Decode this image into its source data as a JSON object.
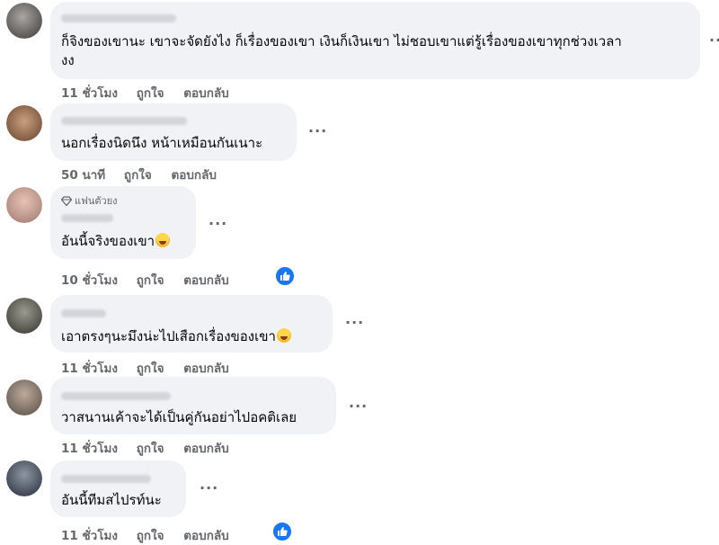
{
  "comments": [
    {
      "author": "",
      "text_lines": [
        "ก็จิงของเขานะ เขาจะจัดยังไง ก็เรื่องของเขา เงินก็เงินเขา ไม่ชอบเขาแต่รู้เรื่องของเขาทุกช่วงเวลา",
        "งง"
      ],
      "time": "11 ชั่วโมง",
      "like": "ถูกใจ",
      "reply": "ตอบกลับ"
    },
    {
      "author": "",
      "text": "นอกเรื่องนิดนึง หน้าเหมือนกันเนาะ",
      "time": "50 นาที",
      "like": "ถูกใจ",
      "reply": "ตอบกลับ"
    },
    {
      "badge": "แฟนตัวยง",
      "author": "",
      "text": "อันนี้จริงของเขา",
      "emoji": "rolling-laugh-emoji",
      "time": "10 ชั่วโมง",
      "like": "ถูกใจ",
      "reply": "ตอบกลับ",
      "reaction": "like"
    },
    {
      "author": "",
      "text": "เอาตรงๆนะมึงน่ะไปเสือกเรื่องของเขา",
      "emoji": "rolling-laugh-emoji",
      "time": "11 ชั่วโมง",
      "like": "ถูกใจ",
      "reply": "ตอบกลับ"
    },
    {
      "author": "",
      "text": "วาสนานเค้าจะได้เป็นคู่กันอย่าไปอคติเลย",
      "time": "11 ชั่วโมง",
      "like": "ถูกใจ",
      "reply": "ตอบกลับ"
    },
    {
      "author": "",
      "text": "อันนี้ทีมสไปรท์นะ",
      "time": "11 ชั่วโมง",
      "like": "ถูกใจ",
      "reply": "ตอบกลับ",
      "reaction": "like"
    }
  ],
  "more_glyph": "···",
  "colors": {
    "bubble": "#f0f2f5",
    "meta": "#65676b",
    "like_blue": "#1877f2"
  }
}
